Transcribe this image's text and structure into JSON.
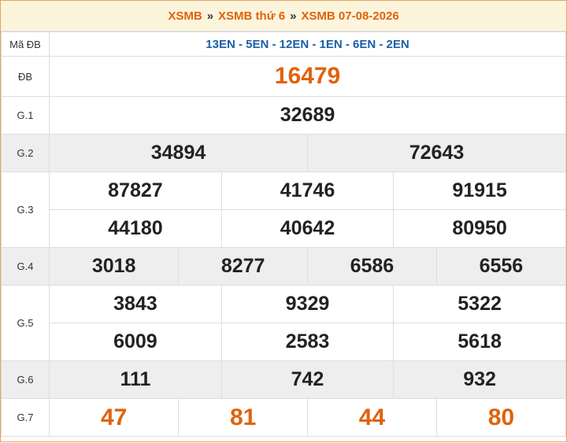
{
  "breadcrumb": {
    "item1": "XSMB",
    "item2": "XSMB thứ 6",
    "item3": "XSMB 07-08-2026",
    "separator": "»"
  },
  "rows": {
    "ma_db": {
      "label": "Mã ĐB",
      "value": "13EN - 5EN - 12EN - 1EN - 6EN - 2EN"
    },
    "db": {
      "label": "ĐB",
      "values": [
        "16479"
      ]
    },
    "g1": {
      "label": "G.1",
      "values": [
        "32689"
      ]
    },
    "g2": {
      "label": "G.2",
      "values": [
        "34894",
        "72643"
      ]
    },
    "g3": {
      "label": "G.3",
      "values": [
        "87827",
        "41746",
        "91915",
        "44180",
        "40642",
        "80950"
      ]
    },
    "g4": {
      "label": "G.4",
      "values": [
        "3018",
        "8277",
        "6586",
        "6556"
      ]
    },
    "g5": {
      "label": "G.5",
      "values": [
        "3843",
        "9329",
        "5322",
        "6009",
        "2583",
        "5618"
      ]
    },
    "g6": {
      "label": "G.6",
      "values": [
        "111",
        "742",
        "932"
      ]
    },
    "g7": {
      "label": "G.7",
      "values": [
        "47",
        "81",
        "44",
        "80"
      ]
    }
  },
  "colors": {
    "accent_orange": "#e0620e",
    "code_blue": "#1a5ea8",
    "header_bg": "#fcf5dc",
    "row_gray": "#eeeeee"
  }
}
